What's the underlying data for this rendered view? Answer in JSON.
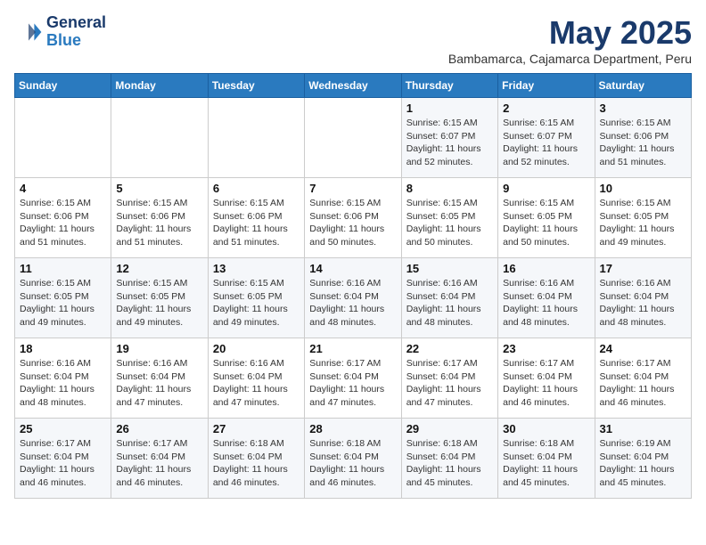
{
  "header": {
    "logo_line1": "General",
    "logo_line2": "Blue",
    "month": "May 2025",
    "location": "Bambamarca, Cajamarca Department, Peru"
  },
  "weekdays": [
    "Sunday",
    "Monday",
    "Tuesday",
    "Wednesday",
    "Thursday",
    "Friday",
    "Saturday"
  ],
  "weeks": [
    [
      {
        "day": "",
        "info": ""
      },
      {
        "day": "",
        "info": ""
      },
      {
        "day": "",
        "info": ""
      },
      {
        "day": "",
        "info": ""
      },
      {
        "day": "1",
        "info": "Sunrise: 6:15 AM\nSunset: 6:07 PM\nDaylight: 11 hours\nand 52 minutes."
      },
      {
        "day": "2",
        "info": "Sunrise: 6:15 AM\nSunset: 6:07 PM\nDaylight: 11 hours\nand 52 minutes."
      },
      {
        "day": "3",
        "info": "Sunrise: 6:15 AM\nSunset: 6:06 PM\nDaylight: 11 hours\nand 51 minutes."
      }
    ],
    [
      {
        "day": "4",
        "info": "Sunrise: 6:15 AM\nSunset: 6:06 PM\nDaylight: 11 hours\nand 51 minutes."
      },
      {
        "day": "5",
        "info": "Sunrise: 6:15 AM\nSunset: 6:06 PM\nDaylight: 11 hours\nand 51 minutes."
      },
      {
        "day": "6",
        "info": "Sunrise: 6:15 AM\nSunset: 6:06 PM\nDaylight: 11 hours\nand 51 minutes."
      },
      {
        "day": "7",
        "info": "Sunrise: 6:15 AM\nSunset: 6:06 PM\nDaylight: 11 hours\nand 50 minutes."
      },
      {
        "day": "8",
        "info": "Sunrise: 6:15 AM\nSunset: 6:05 PM\nDaylight: 11 hours\nand 50 minutes."
      },
      {
        "day": "9",
        "info": "Sunrise: 6:15 AM\nSunset: 6:05 PM\nDaylight: 11 hours\nand 50 minutes."
      },
      {
        "day": "10",
        "info": "Sunrise: 6:15 AM\nSunset: 6:05 PM\nDaylight: 11 hours\nand 49 minutes."
      }
    ],
    [
      {
        "day": "11",
        "info": "Sunrise: 6:15 AM\nSunset: 6:05 PM\nDaylight: 11 hours\nand 49 minutes."
      },
      {
        "day": "12",
        "info": "Sunrise: 6:15 AM\nSunset: 6:05 PM\nDaylight: 11 hours\nand 49 minutes."
      },
      {
        "day": "13",
        "info": "Sunrise: 6:15 AM\nSunset: 6:05 PM\nDaylight: 11 hours\nand 49 minutes."
      },
      {
        "day": "14",
        "info": "Sunrise: 6:16 AM\nSunset: 6:04 PM\nDaylight: 11 hours\nand 48 minutes."
      },
      {
        "day": "15",
        "info": "Sunrise: 6:16 AM\nSunset: 6:04 PM\nDaylight: 11 hours\nand 48 minutes."
      },
      {
        "day": "16",
        "info": "Sunrise: 6:16 AM\nSunset: 6:04 PM\nDaylight: 11 hours\nand 48 minutes."
      },
      {
        "day": "17",
        "info": "Sunrise: 6:16 AM\nSunset: 6:04 PM\nDaylight: 11 hours\nand 48 minutes."
      }
    ],
    [
      {
        "day": "18",
        "info": "Sunrise: 6:16 AM\nSunset: 6:04 PM\nDaylight: 11 hours\nand 48 minutes."
      },
      {
        "day": "19",
        "info": "Sunrise: 6:16 AM\nSunset: 6:04 PM\nDaylight: 11 hours\nand 47 minutes."
      },
      {
        "day": "20",
        "info": "Sunrise: 6:16 AM\nSunset: 6:04 PM\nDaylight: 11 hours\nand 47 minutes."
      },
      {
        "day": "21",
        "info": "Sunrise: 6:17 AM\nSunset: 6:04 PM\nDaylight: 11 hours\nand 47 minutes."
      },
      {
        "day": "22",
        "info": "Sunrise: 6:17 AM\nSunset: 6:04 PM\nDaylight: 11 hours\nand 47 minutes."
      },
      {
        "day": "23",
        "info": "Sunrise: 6:17 AM\nSunset: 6:04 PM\nDaylight: 11 hours\nand 46 minutes."
      },
      {
        "day": "24",
        "info": "Sunrise: 6:17 AM\nSunset: 6:04 PM\nDaylight: 11 hours\nand 46 minutes."
      }
    ],
    [
      {
        "day": "25",
        "info": "Sunrise: 6:17 AM\nSunset: 6:04 PM\nDaylight: 11 hours\nand 46 minutes."
      },
      {
        "day": "26",
        "info": "Sunrise: 6:17 AM\nSunset: 6:04 PM\nDaylight: 11 hours\nand 46 minutes."
      },
      {
        "day": "27",
        "info": "Sunrise: 6:18 AM\nSunset: 6:04 PM\nDaylight: 11 hours\nand 46 minutes."
      },
      {
        "day": "28",
        "info": "Sunrise: 6:18 AM\nSunset: 6:04 PM\nDaylight: 11 hours\nand 46 minutes."
      },
      {
        "day": "29",
        "info": "Sunrise: 6:18 AM\nSunset: 6:04 PM\nDaylight: 11 hours\nand 45 minutes."
      },
      {
        "day": "30",
        "info": "Sunrise: 6:18 AM\nSunset: 6:04 PM\nDaylight: 11 hours\nand 45 minutes."
      },
      {
        "day": "31",
        "info": "Sunrise: 6:19 AM\nSunset: 6:04 PM\nDaylight: 11 hours\nand 45 minutes."
      }
    ]
  ]
}
